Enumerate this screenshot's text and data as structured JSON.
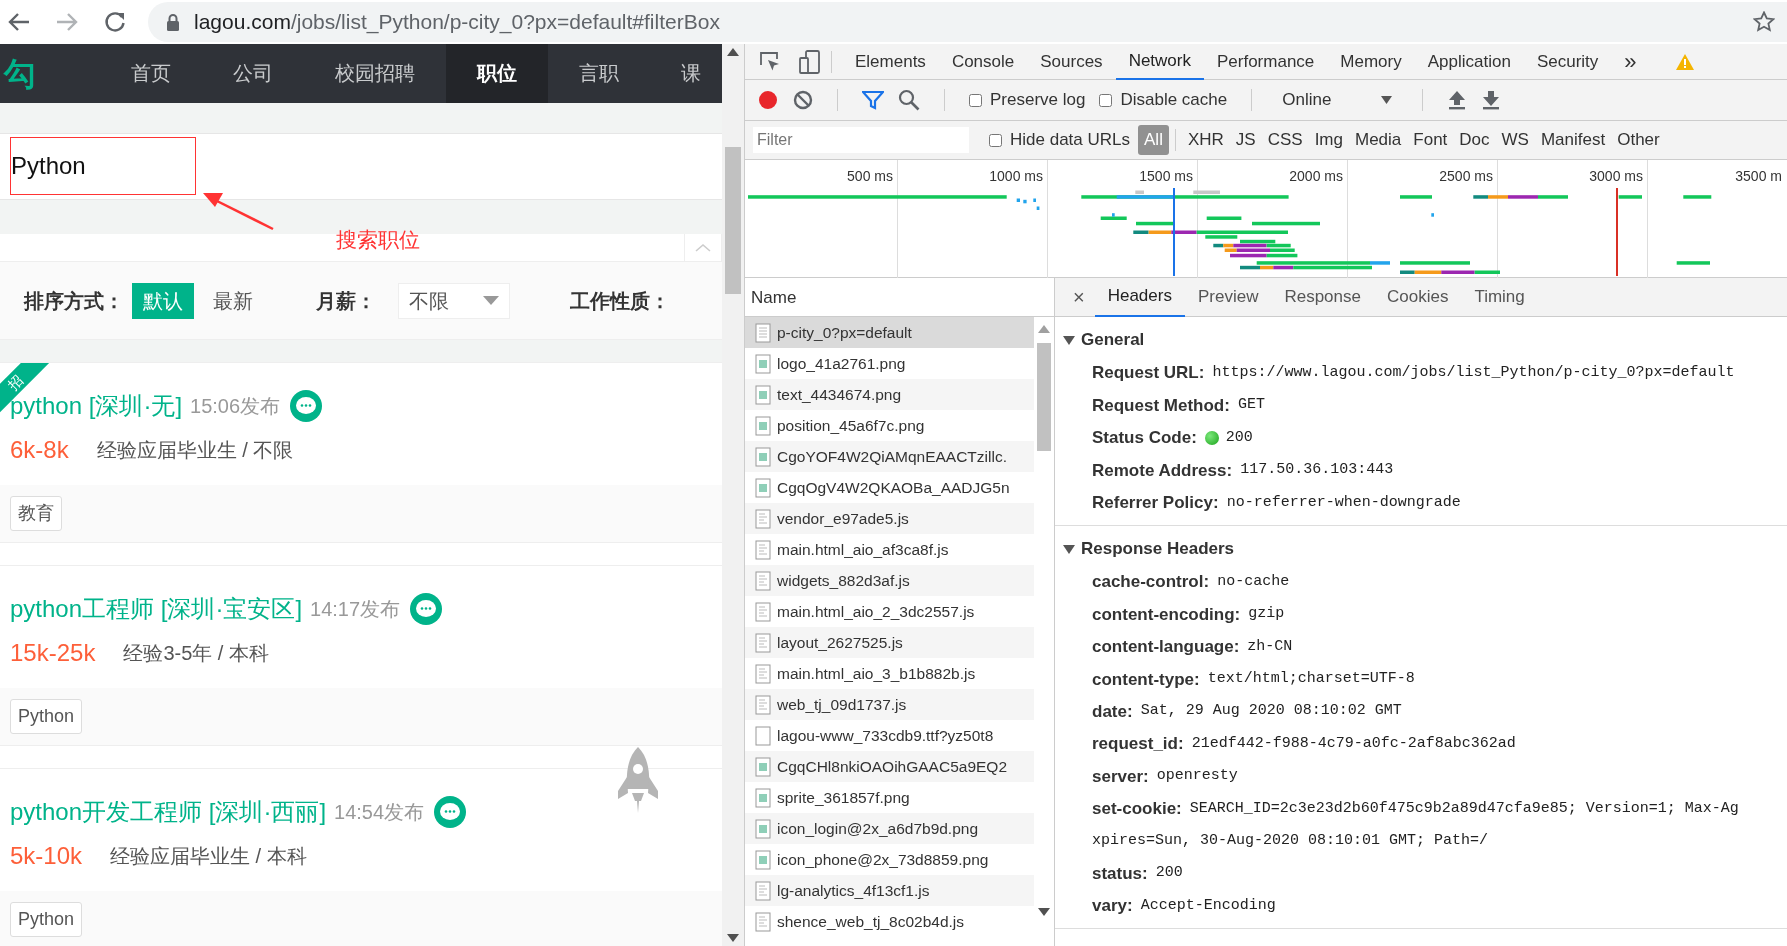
{
  "browser": {
    "url_host": "lagou.com",
    "url_path": "/jobs/list_Python/p-city_0?px=default#filterBox"
  },
  "site": {
    "logo": "勾",
    "nav": [
      {
        "label": "首页",
        "selected": false
      },
      {
        "label": "公司",
        "selected": false
      },
      {
        "label": "校园招聘",
        "selected": false
      },
      {
        "label": "职位",
        "selected": true
      },
      {
        "label": "言职",
        "selected": false
      },
      {
        "label": "课",
        "selected": false
      }
    ],
    "search": {
      "value": "Python"
    },
    "annotation": "搜索职位",
    "filters": {
      "sort_label": "排序方式：",
      "sort_options": [
        {
          "label": "默认",
          "selected": true
        },
        {
          "label": "最新",
          "selected": false
        }
      ],
      "salary_label": "月薪：",
      "salary_value": "不限",
      "nature_label": "工作性质："
    },
    "jobs": [
      {
        "ribbon": "招",
        "title": "python [深圳·无]",
        "time": "15:06发布",
        "salary": "6k-8k",
        "requirements": "经验应届毕业生 / 不限",
        "tags": [
          "教育"
        ]
      },
      {
        "title": "python工程师 [深圳·宝安区]",
        "time": "14:17发布",
        "salary": "15k-25k",
        "requirements": "经验3-5年 / 本科",
        "tags": [
          "Python"
        ]
      },
      {
        "title": "python开发工程师 [深圳·西丽]",
        "time": "14:54发布",
        "salary": "5k-10k",
        "requirements": "经验应届毕业生 / 本科",
        "tags": [
          "Python"
        ]
      }
    ]
  },
  "devtools": {
    "panel_tabs": [
      {
        "label": "Elements",
        "selected": false
      },
      {
        "label": "Console",
        "selected": false
      },
      {
        "label": "Sources",
        "selected": false
      },
      {
        "label": "Network",
        "selected": true
      },
      {
        "label": "Performance",
        "selected": false
      },
      {
        "label": "Memory",
        "selected": false
      },
      {
        "label": "Application",
        "selected": false
      },
      {
        "label": "Security",
        "selected": false
      }
    ],
    "overflow": "»",
    "toolbar": {
      "recording": true,
      "filter_active": true,
      "checkboxes": [
        {
          "label": "Preserve log",
          "checked": false
        },
        {
          "label": "Disable cache",
          "checked": false
        }
      ],
      "throttle": "Online"
    },
    "filter": {
      "placeholder": "Filter",
      "hide_data_urls": {
        "label": "Hide data URLs",
        "checked": false
      },
      "types": [
        {
          "label": "All",
          "selected": true
        },
        {
          "label": "XHR",
          "selected": false
        },
        {
          "label": "JS",
          "selected": false
        },
        {
          "label": "CSS",
          "selected": false
        },
        {
          "label": "Img",
          "selected": false
        },
        {
          "label": "Media",
          "selected": false
        },
        {
          "label": "Font",
          "selected": false
        },
        {
          "label": "Doc",
          "selected": false
        },
        {
          "label": "WS",
          "selected": false
        },
        {
          "label": "Manifest",
          "selected": false
        },
        {
          "label": "Other",
          "selected": false
        }
      ]
    },
    "timeline": {
      "ticks": [
        "500 ms",
        "1000 ms",
        "1500 ms",
        "2000 ms",
        "2500 ms",
        "3000 ms",
        "3500 m"
      ]
    },
    "requests": {
      "column": "Name",
      "rows": [
        {
          "name": "p-city_0?px=default",
          "kind": "document",
          "selected": true
        },
        {
          "name": "logo_41a2761.png",
          "kind": "image",
          "selected": false
        },
        {
          "name": "text_4434674.png",
          "kind": "image",
          "selected": false
        },
        {
          "name": "position_45a6f7c.png",
          "kind": "image",
          "selected": false
        },
        {
          "name": "CgoYOF4W2QiAMqnEAACTzillc.",
          "kind": "image",
          "selected": false
        },
        {
          "name": "CgqOgV4W2QKAOBa_AADJG5n",
          "kind": "image",
          "selected": false
        },
        {
          "name": "vendor_e97ade5.js",
          "kind": "script",
          "selected": false
        },
        {
          "name": "main.html_aio_af3ca8f.js",
          "kind": "script",
          "selected": false
        },
        {
          "name": "widgets_882d3af.js",
          "kind": "script",
          "selected": false
        },
        {
          "name": "main.html_aio_2_3dc2557.js",
          "kind": "script",
          "selected": false
        },
        {
          "name": "layout_2627525.js",
          "kind": "script",
          "selected": false
        },
        {
          "name": "main.html_aio_3_b1b882b.js",
          "kind": "script",
          "selected": false
        },
        {
          "name": "web_tj_09d1737.js",
          "kind": "script",
          "selected": false
        },
        {
          "name": "lagou-www_733cdb9.ttf?yz50t8",
          "kind": "font",
          "selected": false
        },
        {
          "name": "CgqCHl8nkiOAOihGAAC5a9EQ2",
          "kind": "image",
          "selected": false
        },
        {
          "name": "sprite_361857f.png",
          "kind": "image",
          "selected": false
        },
        {
          "name": "icon_login@2x_a6d7b9d.png",
          "kind": "image",
          "selected": false
        },
        {
          "name": "icon_phone@2x_73d8859.png",
          "kind": "image",
          "selected": false
        },
        {
          "name": "lg-analytics_4f13cf1.js",
          "kind": "script",
          "selected": false
        },
        {
          "name": "shence_web_tj_8c02b4d.js",
          "kind": "script",
          "selected": false
        }
      ]
    },
    "details": {
      "close": "×",
      "tabs": [
        {
          "label": "Headers",
          "selected": true
        },
        {
          "label": "Preview",
          "selected": false
        },
        {
          "label": "Response",
          "selected": false
        },
        {
          "label": "Cookies",
          "selected": false
        },
        {
          "label": "Timing",
          "selected": false
        }
      ],
      "sections": [
        {
          "title": "General",
          "expanded": true,
          "rows": [
            {
              "kind": "plain",
              "label": "Request URL:",
              "value": "https://www.lagou.com/jobs/list_Python/p-city_0?px=default"
            },
            {
              "kind": "plain",
              "label": "Request Method:",
              "value": "GET"
            },
            {
              "kind": "status",
              "label": "Status Code:",
              "value": "200"
            },
            {
              "kind": "plain",
              "label": "Remote Address:",
              "value": "117.50.36.103:443"
            },
            {
              "kind": "plain",
              "label": "Referrer Policy:",
              "value": "no-referrer-when-downgrade"
            }
          ]
        },
        {
          "title": "Response Headers",
          "expanded": true,
          "rows": [
            {
              "kind": "plain",
              "label": "cache-control:",
              "value": "no-cache"
            },
            {
              "kind": "plain",
              "label": "content-encoding:",
              "value": "gzip"
            },
            {
              "kind": "plain",
              "label": "content-language:",
              "value": "zh-CN"
            },
            {
              "kind": "plain",
              "label": "content-type:",
              "value": "text/html;charset=UTF-8"
            },
            {
              "kind": "plain",
              "label": "date:",
              "value": "Sat, 29 Aug 2020 08:10:02 GMT"
            },
            {
              "kind": "plain",
              "label": "request_id:",
              "value": "21edf442-f988-4c79-a0fc-2af8abc362ad"
            },
            {
              "kind": "plain",
              "label": "server:",
              "value": "openresty"
            },
            {
              "kind": "plain",
              "label": "set-cookie:",
              "value": "SEARCH_ID=2c3e23d2b60f475c9b2a89d47cfa9e85; Version=1; Max-Ag"
            },
            {
              "kind": "continuation",
              "value": "xpires=Sun, 30-Aug-2020 08:10:01 GMT; Path=/"
            },
            {
              "kind": "plain",
              "label": "status:",
              "value": "200"
            },
            {
              "kind": "plain",
              "label": "vary:",
              "value": "Accept-Encoding"
            }
          ]
        }
      ]
    }
  }
}
